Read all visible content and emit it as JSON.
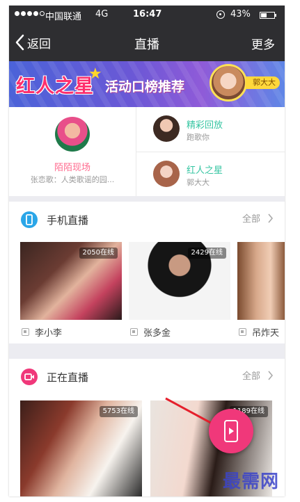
{
  "status_bar": {
    "carrier": "中国联通",
    "network": "4G",
    "time": "16:47",
    "battery": "43%",
    "battery_level": 0.43
  },
  "nav": {
    "back_label": "返回",
    "title": "直播",
    "more_label": "更多"
  },
  "banner": {
    "title_a": "红人之星",
    "title_b": "活动口榜推荐",
    "tag": "郭大大"
  },
  "features": {
    "main": {
      "title": "陌陌现场",
      "subtitle": "张恋歌：人类歌谣的园..."
    },
    "items": [
      {
        "title": "精彩回放",
        "subtitle": "跑歌你"
      },
      {
        "title": "红人之星",
        "subtitle": "郭大大"
      }
    ]
  },
  "sections": {
    "phone_live": {
      "title": "手机直播",
      "all_label": "全部",
      "icon_color": "#2aa6e8",
      "cards": [
        {
          "count": "2050在线",
          "name": "李小李"
        },
        {
          "count": "2429在线",
          "name": "张多金"
        },
        {
          "count": "",
          "name": "吊炸天"
        }
      ]
    },
    "live_now": {
      "title": "正在直播",
      "all_label": "全部",
      "icon_color": "#f0387a",
      "cards": [
        {
          "count": "5753在线"
        },
        {
          "count": "1189在线"
        }
      ]
    }
  },
  "colors": {
    "nav_bg": "#2e2e31",
    "accent_pink": "#f0387a",
    "accent_green": "#36c5a2"
  },
  "watermark": "最需网"
}
